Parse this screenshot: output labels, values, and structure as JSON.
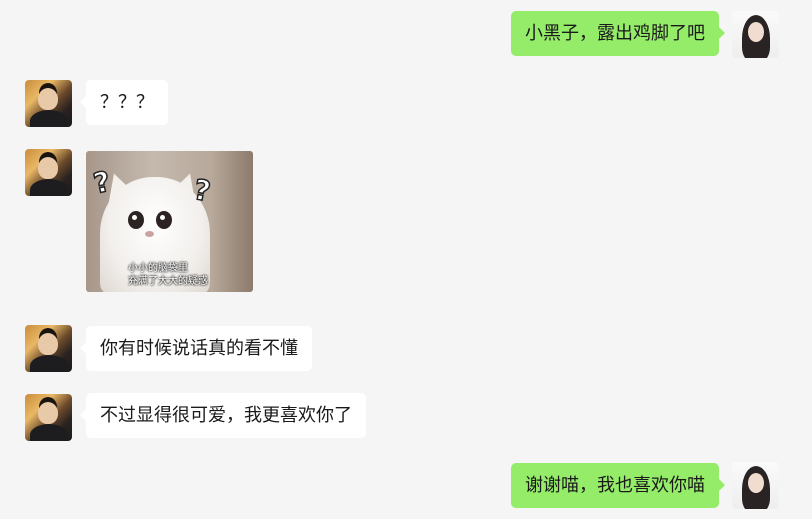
{
  "messages": [
    {
      "side": "out",
      "text": "小黑子，露出鸡脚了吧"
    },
    {
      "side": "in",
      "text": "？？？"
    },
    {
      "side": "in",
      "type": "sticker",
      "caption_line1": "小小的脑袋里",
      "caption_line2": "充满了大大的疑惑"
    },
    {
      "side": "in",
      "text": "你有时候说话真的看不懂"
    },
    {
      "side": "in",
      "text": "不过显得很可爱，我更喜欢你了"
    },
    {
      "side": "out",
      "text": "谢谢喵，我也喜欢你喵"
    }
  ],
  "colors": {
    "background": "#f5f5f5",
    "outgoing_bubble": "#95ec69",
    "incoming_bubble": "#ffffff",
    "text": "#1a1a1a"
  }
}
